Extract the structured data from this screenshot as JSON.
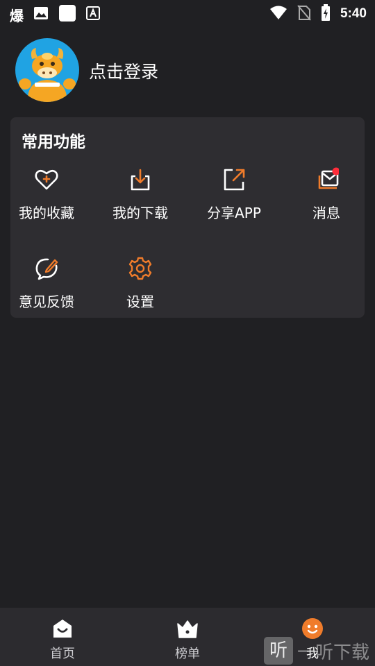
{
  "status_bar": {
    "app_char": "爆",
    "time": "5:40",
    "icons": [
      "image-icon",
      "blank-square-icon",
      "a-square-icon",
      "wifi-icon",
      "no-sim-icon",
      "battery-charging-icon"
    ]
  },
  "profile": {
    "login_text": "点击登录"
  },
  "card": {
    "title": "常用功能",
    "items": [
      {
        "label": "我的收藏",
        "icon": "heart-plus-icon"
      },
      {
        "label": "我的下载",
        "icon": "download-icon"
      },
      {
        "label": "分享APP",
        "icon": "share-icon"
      },
      {
        "label": "消息",
        "icon": "message-icon",
        "badge": true
      },
      {
        "label": "意见反馈",
        "icon": "feedback-edit-icon"
      },
      {
        "label": "设置",
        "icon": "gear-icon"
      }
    ]
  },
  "bottom_nav": {
    "items": [
      {
        "label": "首页",
        "icon": "home-icon",
        "active": false
      },
      {
        "label": "榜单",
        "icon": "crown-icon",
        "active": false
      },
      {
        "label": "我",
        "icon": "smiley-icon",
        "active": true
      }
    ]
  },
  "watermark": {
    "char": "听",
    "text": "一听下载"
  },
  "colors": {
    "background": "#202023",
    "card": "#2e2d31",
    "accent": "#f07c2b",
    "badge": "#ff2d3a"
  }
}
